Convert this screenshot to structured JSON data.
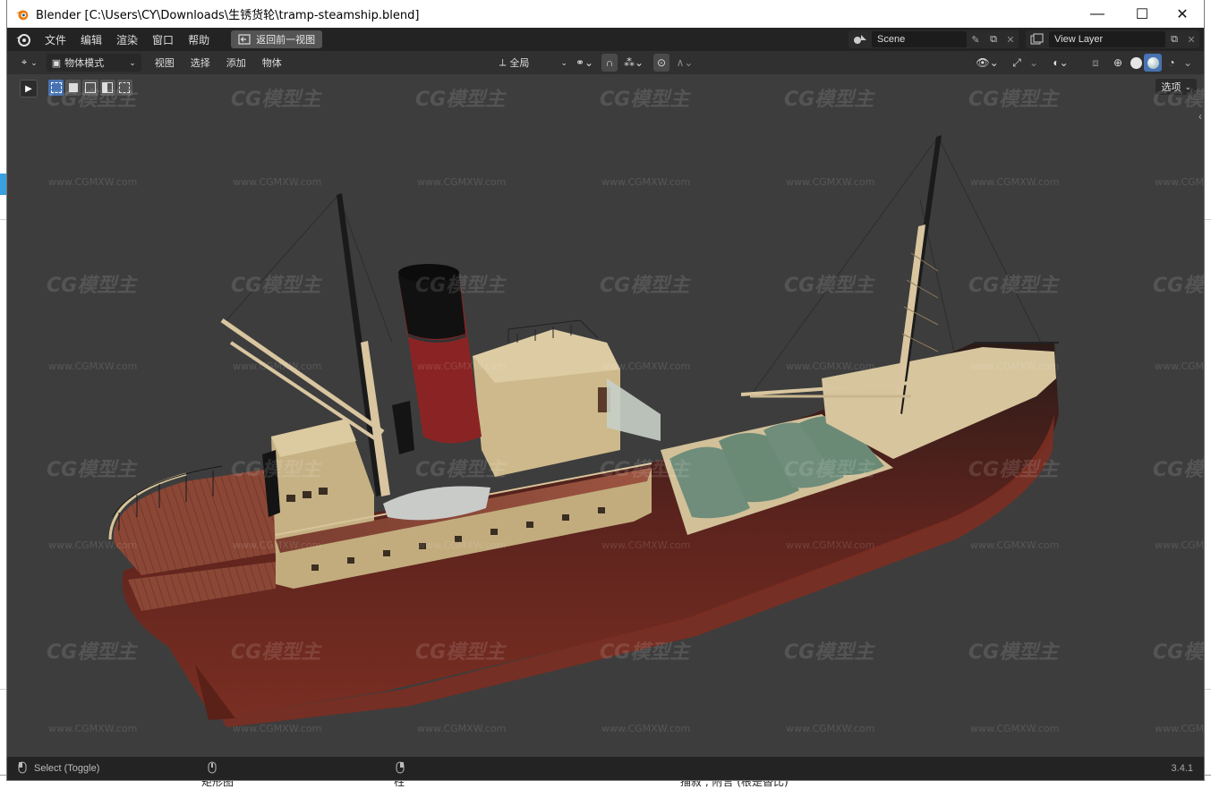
{
  "window": {
    "title": "Blender [C:\\Users\\CY\\Downloads\\生锈货轮\\tramp-steamship.blend]",
    "controls": {
      "minimize": "—",
      "maximize": "☐",
      "close": "✕"
    }
  },
  "topbar": {
    "menus": [
      "文件",
      "编辑",
      "渲染",
      "窗口",
      "帮助"
    ],
    "back_button": "返回前一视图",
    "scene": "Scene",
    "view_layer": "View Layer"
  },
  "header": {
    "mode": "物体模式",
    "menus": [
      "视图",
      "选择",
      "添加",
      "物体"
    ],
    "transform_orientation": "全局",
    "options": "选项"
  },
  "statusbar": {
    "hint": "Select (Toggle)",
    "version": "3.4.1"
  },
  "watermark": {
    "logo_text": "CG模型主",
    "url_text": "www.CGMXW.com"
  },
  "background_doc": {
    "bottom_texts": [
      "矩形图",
      "柱",
      "描叙 , 附言 (根是替比)"
    ]
  },
  "colors": {
    "viewport_bg": "#3d3d3d",
    "hull_red": "#6b2a22",
    "deck_wood": "#8c4a38",
    "superstructure": "#c9b48c",
    "funnel_red": "#8a2424",
    "tarp_green": "#6f8d7a"
  }
}
